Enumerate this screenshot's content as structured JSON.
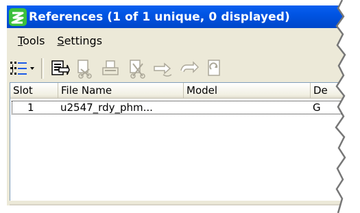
{
  "window": {
    "title": "References (1 of 1 unique, 0 displayed)"
  },
  "menu": {
    "tools": "Tools",
    "settings": "Settings"
  },
  "toolbar": {
    "icons": [
      "list-view-icon",
      "dropdown-arrow-icon",
      "attach-reference-icon",
      "detach-reference-icon",
      "print-reference-icon",
      "clip-reference-icon",
      "move-reference-icon",
      "rotate-reference-icon",
      "reload-reference-icon"
    ]
  },
  "table": {
    "columns": [
      "Slot",
      "File Name",
      "Model",
      "De"
    ],
    "rows": [
      {
        "slot": "1",
        "file_name": "u2547_rdy_phm...",
        "model": "",
        "desc": "G"
      }
    ]
  },
  "colors": {
    "title_bar": "#0054e3",
    "window_bg": "#ece9d8",
    "list_bg": "#ffffff"
  }
}
